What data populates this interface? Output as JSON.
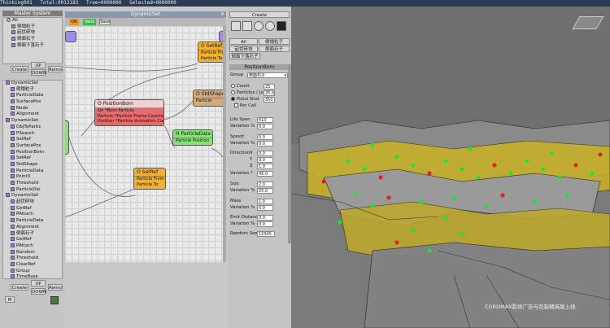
{
  "titlebar": {
    "app": "Thinking001",
    "total": "Total:0013183",
    "tree": "Tree=0000000",
    "selected": "Selected=0000000"
  },
  "master": {
    "title": "Master System",
    "root": "All",
    "groups": [
      "倒塌粒子",
      "起伏碎块",
      "倒面石子",
      "倒面下落石子"
    ],
    "buttons": {
      "create": "Create",
      "up": "UP",
      "down": "DOWN",
      "remove": "Remo"
    }
  },
  "tree": [
    "DynamicSet",
    "倒塌粒子",
    "ParticleData",
    "SurfacePos",
    "Node",
    "Alignment",
    "DynamicSet",
    "ObjToPartic",
    "PSearch",
    "SetRef",
    "SurfacePos",
    "PositionBorn",
    "SetRef",
    "StdShape",
    "ParticleData",
    "Point3",
    "Threshold",
    "ParticleDie",
    "DynamicSet",
    "起伏碎块",
    "GetRef",
    "PAttach",
    "ParticleData",
    "Alignment",
    "倒面石子",
    "GetRef",
    "PAttach",
    "Random",
    "Threshold",
    "ClearRef",
    "Group",
    "TimeBase"
  ],
  "bottom": {
    "create": "Create",
    "up": "UP",
    "down": "DOWN",
    "remove": "Remo",
    "m": "M"
  },
  "dynamicset": {
    "title": "DynamicSet",
    "on": "ON",
    "valid": "Valid",
    "save": "Save",
    "nodes": [
      {
        "title": "O SetRef",
        "rows": [
          "Particle From",
          "Particle To"
        ]
      },
      {
        "title": "O PositionBorn",
        "rows": [
          "On      *Born Particle",
          "Particle  *Particle Frame Counter",
          "Position  *Particle Animation Counter"
        ]
      },
      {
        "title": "O StdShape",
        "rows": [
          "Particle"
        ]
      },
      {
        "title": "H ParticleData",
        "rows": [
          "Particle    Position"
        ]
      },
      {
        "title": "O SetRef",
        "rows": [
          "Particle From",
          "Particle To"
        ]
      }
    ]
  },
  "props": {
    "create": "Create",
    "all": "All",
    "g1": "倒塌粒子",
    "g2": "起伏碎块",
    "g3": "倒面石子",
    "g4": "倒面下落石子",
    "rollout": "PositionBorn",
    "group_label": "Group",
    "group_value": "倒面石子",
    "count_label": "Count",
    "count_value": "25",
    "ps_label": "Particles / [s]",
    "ps_value": "25.0",
    "shot_label": "Pistol Shot",
    "shot_value": "350",
    "percall": "Per Call",
    "lifespan_label": "Life Span",
    "lifespan_value": "610",
    "var1_label": "Variation",
    "var1_unit": "%",
    "var1_value": "0.0",
    "speed_label": "Speed",
    "speed_value": "0.0",
    "var2_label": "Variation",
    "var2_unit": "%",
    "var2_value": "0.0",
    "dir_label": "Direction",
    "x_label": "X",
    "x_value": "0.0",
    "y_label": "Y",
    "y_value": "0.0",
    "z_label": "Z",
    "z_value": "1.0",
    "var3_label": "Variation",
    "var3_unit": "*",
    "var3_value": "45.0",
    "size_label": "Size",
    "size_value": "2.0",
    "var4_label": "Variation",
    "var4_unit": "%",
    "var4_value": "25.0",
    "mass_label": "Mass",
    "mass_value": "1.0",
    "var5_label": "Variation",
    "var5_unit": "%",
    "var5_value": "0.0",
    "emit_label": "Emit Distance",
    "emit_value": "0.0",
    "var6_label": "Variation",
    "var6_unit": "%",
    "var6_value": "0.0",
    "seed_label": "Random Seed",
    "seed_value": "12345"
  },
  "viewport": {
    "watermark": "CGRDMAX影视广告与包装精英版上线"
  }
}
